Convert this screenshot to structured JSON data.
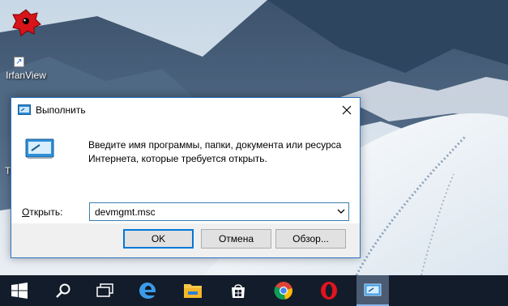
{
  "desktop": {
    "icon_label": "IrfanView",
    "partial_label": "T"
  },
  "dialog": {
    "title": "Выполнить",
    "description_line1": "Введите имя программы, папки, документа или ресурса",
    "description_line2": "Интернета, которые требуется открыть.",
    "open_label_prefix": "О",
    "open_label_rest": "ткрыть:",
    "input_value": "devmgmt.msc",
    "ok_label": "OK",
    "cancel_label": "Отмена",
    "browse_label": "Обзор..."
  },
  "taskbar": {
    "items": [
      "windows-start-icon",
      "search-icon",
      "task-view-icon",
      "edge-icon",
      "file-explorer-icon",
      "store-icon",
      "chrome-icon",
      "opera-icon",
      "run-icon"
    ],
    "active_item": "run-icon"
  },
  "colors": {
    "accent": "#0078d7",
    "taskbar": "#131c2a",
    "dialog_border": "#2a73c6"
  }
}
